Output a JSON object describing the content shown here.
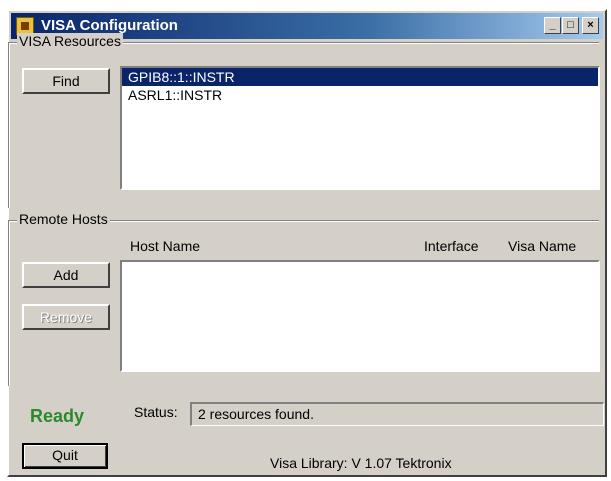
{
  "window": {
    "title": "VISA Configuration",
    "controls": {
      "minimize": "_",
      "maximize": "□",
      "close": "×"
    }
  },
  "resources": {
    "group_label": "VISA Resources",
    "find_label": "Find",
    "items": [
      {
        "label": "GPIB8::1::INSTR",
        "selected": true
      },
      {
        "label": "ASRL1::INSTR",
        "selected": false
      }
    ]
  },
  "remote_hosts": {
    "group_label": "Remote Hosts",
    "columns": {
      "host_name": "Host Name",
      "interface": "Interface",
      "visa_name": "Visa Name"
    },
    "add_label": "Add",
    "remove_label": "Remove",
    "rows": []
  },
  "status": {
    "ready": "Ready",
    "label": "Status:",
    "message": "2 resources found."
  },
  "footer": {
    "quit_label": "Quit",
    "library": "Visa Library: V 1.07  Tektronix"
  },
  "colors": {
    "title_start": "#0a246a",
    "title_end": "#a6caf0",
    "selection": "#0a246a",
    "ready_green": "#2a8a2a",
    "face": "#d4d0c8"
  }
}
